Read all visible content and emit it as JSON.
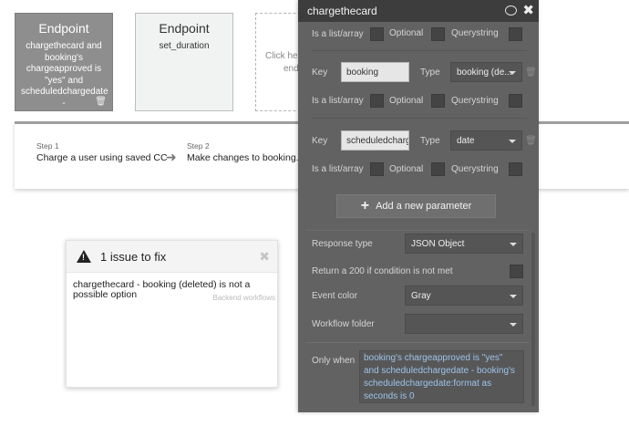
{
  "canvas": {
    "card1": {
      "title": "Endpoint",
      "text": "chargethecard and booking's chargeapproved is \"yes\" and scheduledchargedate -",
      "trash_icon": "trash-icon"
    },
    "card2": {
      "title": "Endpoint",
      "text": "set_duration"
    },
    "card3": {
      "line1": "Click her",
      "line2": "end"
    },
    "steps": [
      {
        "num": "Step 1",
        "name": "Charge a user using saved CC"
      },
      {
        "num": "Step 2",
        "name": "Make changes to booking..."
      }
    ],
    "arrow_icon": "arrow-right-icon"
  },
  "issues": {
    "title": "1 issue to fix",
    "message": "chargethecard - booking (deleted) is not a possible option",
    "link": "Backend workflows"
  },
  "editor": {
    "title": "chargethecard",
    "labels": {
      "is_list": "Is a list/array",
      "optional": "Optional",
      "querystring": "Querystring",
      "key": "Key",
      "type": "Type"
    },
    "params": [
      {
        "key": "booking",
        "type": "booking (de..."
      },
      {
        "key": "scheduledcharg",
        "type": "date"
      }
    ],
    "add_param": "Add a new parameter",
    "response_type": {
      "label": "Response type",
      "value": "JSON Object"
    },
    "return_200": {
      "label": "Return a 200 if condition is not met"
    },
    "event_color": {
      "label": "Event color",
      "value": "Gray"
    },
    "workflow_folder": {
      "label": "Workflow folder",
      "value": ""
    },
    "only_when": {
      "label": "Only when",
      "expression": "booking's chargeapproved is \"yes\" and scheduledchargedate - booking's scheduledchargedate:format as seconds is 0"
    }
  },
  "colors": {
    "editor_bg": "#626262",
    "editor_header": "#3d3d3d",
    "expression_text": "#9dc3e9"
  }
}
